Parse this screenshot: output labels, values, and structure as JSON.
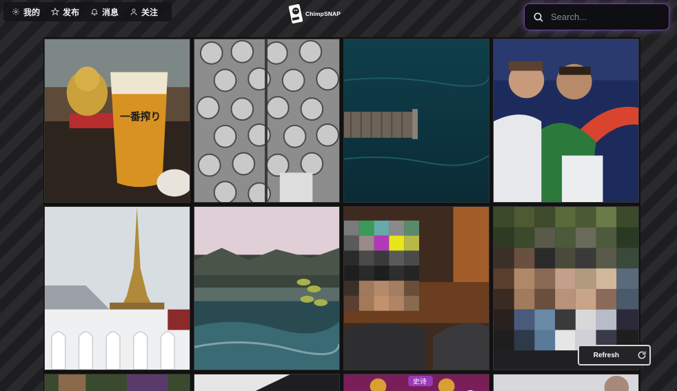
{
  "nav": {
    "items": [
      {
        "label": "我的",
        "icon": "gear-icon"
      },
      {
        "label": "发布",
        "icon": "star-icon"
      },
      {
        "label": "消息",
        "icon": "bell-icon"
      },
      {
        "label": "关注",
        "icon": "user-icon"
      }
    ]
  },
  "brand": {
    "name": "ChimpSNAP"
  },
  "search": {
    "placeholder": "Search..."
  },
  "refresh": {
    "label": "Refresh"
  },
  "photos": {
    "glass_text": "一番搾り",
    "game_banner_text": "史诗"
  },
  "colors": {
    "search_glow": "#8c5ac8",
    "background": "#1e1e20"
  }
}
